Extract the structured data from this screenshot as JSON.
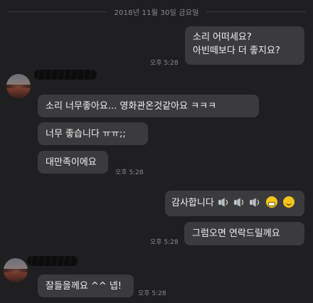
{
  "date_separator": "2018년 11월 30일 금요일",
  "messages": [
    {
      "text_line1": "소리 어떠세요?",
      "text_line2": "아빈떼보다 더 좋지요?",
      "time": "오후 5:28"
    },
    {
      "text": "소리 너무좋아요... 영화관온것같아요 ㅋㅋㅋ"
    },
    {
      "text": "너무 좋습니다 ㅠㅠ;;"
    },
    {
      "text": "대만족이에요",
      "time": "오후 5:28"
    },
    {
      "text": "감사합니다",
      "icons": [
        "speaker-icon",
        "speaker-icon",
        "speaker-icon",
        "grinning-face-icon",
        "smiling-face-icon"
      ]
    },
    {
      "text": "그럼오면 연락드릴께요",
      "time": "오후 5:28"
    },
    {
      "text": "잘들을께요 ^^ 넵!",
      "time": "오후 5:28"
    }
  ]
}
